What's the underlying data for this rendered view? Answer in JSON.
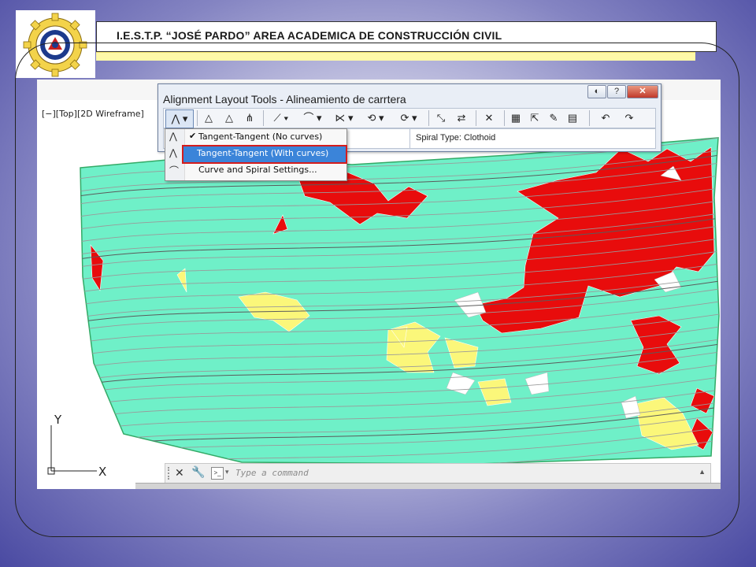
{
  "header": {
    "title": "I.E.S.T.P. “JOSÉ PARDO” AREA ACADEMICA DE CONSTRUCCIÓN CIVIL"
  },
  "viewport": {
    "label": "[−][Top][2D Wireframe]"
  },
  "command_line": {
    "placeholder": "Type a command"
  },
  "ucs": {
    "y_label": "Y",
    "x_label": "X"
  },
  "alignment_tools": {
    "title": "Alignment Layout Tools - Alineamiento de carrtera",
    "spiral_type": "Spiral Type: Clothoid",
    "window_buttons": [
      "?",
      "✕"
    ]
  },
  "dropdown_menu": {
    "items": [
      {
        "label": "Tangent-Tangent (No curves)",
        "checked": true,
        "icon": "tangent-icon"
      },
      {
        "label": "Tangent-Tangent (With curves)",
        "checked": false,
        "icon": "tangent-curve-icon",
        "highlighted": true
      },
      {
        "label": "Curve and Spiral Settings...",
        "checked": false,
        "icon": "curve-settings-icon"
      }
    ]
  },
  "colors": {
    "terrain": "#6ff0c8",
    "slope_steep": "#e80c0c",
    "slope_medium": "#fbf77a",
    "contour": "#9a9a9a",
    "highlight": "#3b84d9",
    "highlight_border": "#d51c1c"
  }
}
